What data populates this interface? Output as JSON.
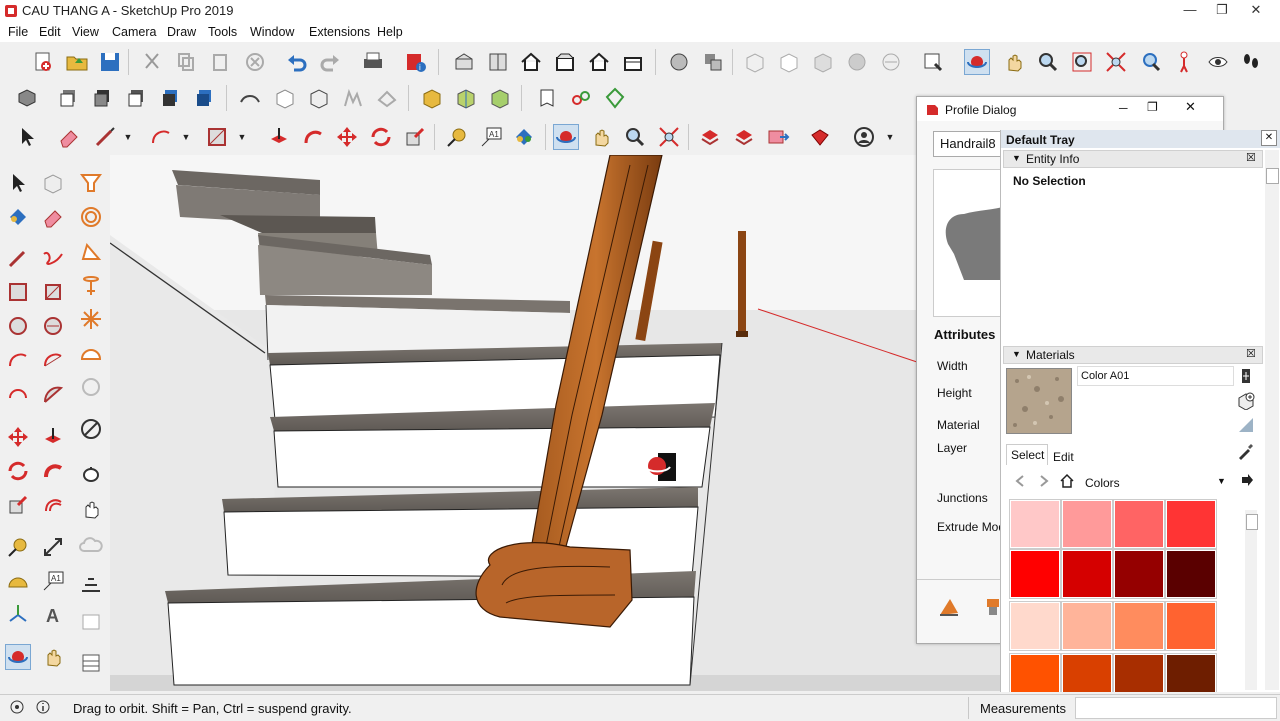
{
  "window": {
    "title": "CAU THANG A - SketchUp Pro 2019"
  },
  "menu": [
    "File",
    "Edit",
    "View",
    "Camera",
    "Draw",
    "Tools",
    "Window",
    "Extensions",
    "Help"
  ],
  "profile_dialog": {
    "title": "Profile Dialog",
    "name_value": "Handrail8",
    "attributes_label": "Attributes",
    "fields": [
      "Width",
      "Height",
      "Material",
      "Layer",
      "Junctions",
      "Extrude Mode"
    ]
  },
  "tray": {
    "title": "Default Tray",
    "entity_info": {
      "header": "Entity Info",
      "selection": "No Selection"
    },
    "materials": {
      "header": "Materials",
      "material_name": "Color A01",
      "tab_select": "Select",
      "tab_edit": "Edit",
      "library": "Colors",
      "swatches": [
        "#ffc8c8",
        "#ff9a9a",
        "#ff6464",
        "#ff3434",
        "#ff0000",
        "#d50000",
        "#950000",
        "#5a0000",
        "#ffd9cc",
        "#ffb49a",
        "#ff8c5e",
        "#ff6330",
        "#ff5200",
        "#d94000",
        "#a82e00",
        "#6e1e00"
      ]
    }
  },
  "status": {
    "hint": "Drag to orbit. Shift = Pan, Ctrl = suspend gravity.",
    "measurements_label": "Measurements"
  },
  "colors": {
    "accent_red": "#d52b2b",
    "wood": "#8b4513",
    "selection_blue": "#cfe0f0"
  }
}
